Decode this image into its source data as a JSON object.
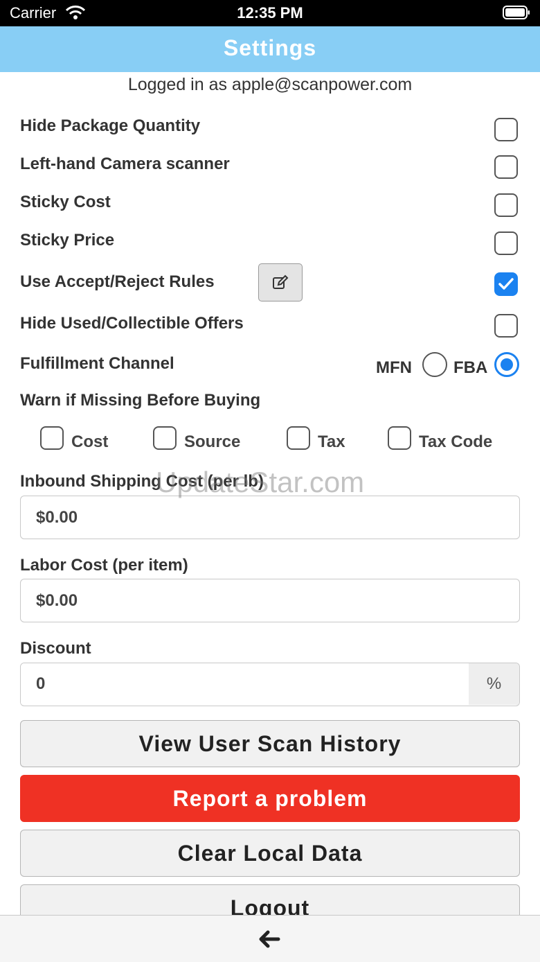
{
  "status_bar": {
    "carrier": "Carrier",
    "time": "12:35 PM",
    "wifi_icon": "wifi-icon",
    "battery_icon": "battery-icon"
  },
  "header": {
    "title": "Settings"
  },
  "login_note": "Logged in as apple@scanpower.com",
  "toggles": [
    {
      "label": "Hide Package Quantity",
      "checked": false
    },
    {
      "label": "Left-hand Camera scanner",
      "checked": false
    },
    {
      "label": "Sticky Cost",
      "checked": false
    },
    {
      "label": "Sticky Price",
      "checked": false
    },
    {
      "label": "Use Accept/Reject Rules",
      "checked": true
    },
    {
      "label": "Hide Used/Collectible Offers",
      "checked": false
    }
  ],
  "fulfillment": {
    "label": "Fulfillment Channel",
    "options": [
      "MFN",
      "FBA"
    ],
    "selected": "FBA"
  },
  "warn": {
    "label": "Warn if Missing Before Buying",
    "options": [
      "Cost",
      "Source",
      "Tax",
      "Tax Code"
    ]
  },
  "inbound": {
    "label": "Inbound Shipping Cost (per lb)",
    "value": "$0.00"
  },
  "labor": {
    "label": "Labor Cost (per item)",
    "value": "$0.00"
  },
  "discount": {
    "label": "Discount",
    "value": "0",
    "suffix": "%"
  },
  "buttons": {
    "scan_history": "View User Scan History",
    "report": "Report a problem",
    "clear": "Clear Local Data",
    "logout": "Logout"
  },
  "watermark": "UpdateStar.com",
  "colors": {
    "header": "#88cef5",
    "accent": "#1b82f0",
    "danger": "#ef3124"
  }
}
